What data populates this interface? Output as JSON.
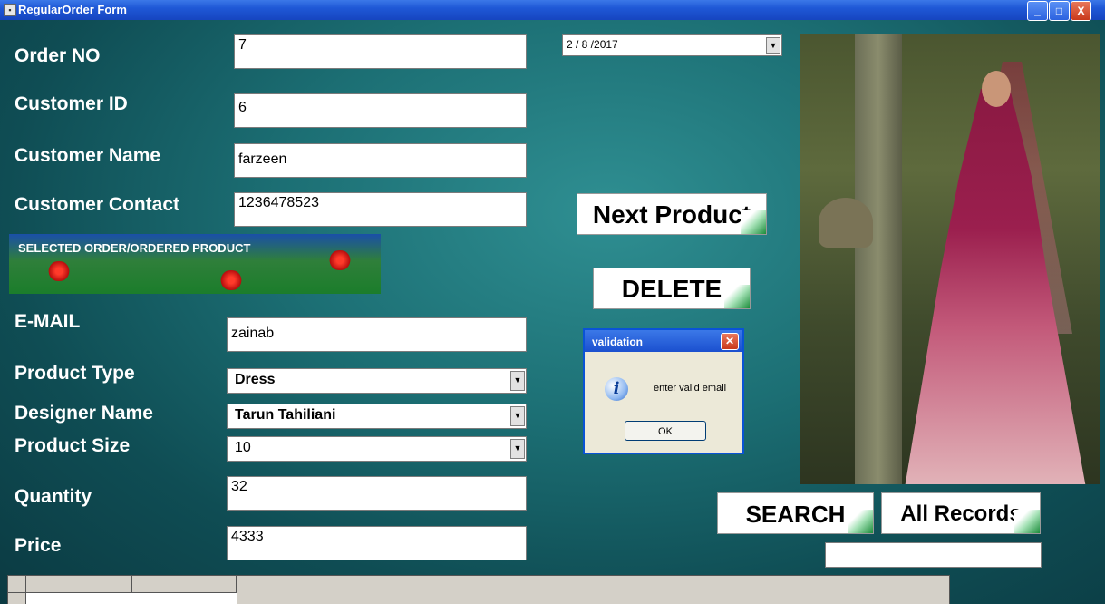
{
  "window": {
    "title": "RegularOrder Form",
    "controls": {
      "minimize": "_",
      "maximize": "□",
      "close": "X"
    }
  },
  "form": {
    "order_no": {
      "label": "Order NO",
      "value": "7"
    },
    "customer_id": {
      "label": "Customer ID",
      "value": "6"
    },
    "customer_name": {
      "label": "Customer Name",
      "value": "farzeen"
    },
    "customer_contact": {
      "label": "Customer Contact",
      "value": "1236478523"
    },
    "email": {
      "label": "E-MAIL",
      "value": "zainab"
    },
    "product_type": {
      "label": "Product Type",
      "value": "Dress"
    },
    "designer_name": {
      "label": "Designer Name",
      "value": "Tarun Tahiliani"
    },
    "product_size": {
      "label": "Product Size",
      "value": "10"
    },
    "quantity": {
      "label": "Quantity",
      "value": "32"
    },
    "price": {
      "label": "Price",
      "value": "4333"
    }
  },
  "date_picker": {
    "value": "2 / 8 /2017"
  },
  "banner": {
    "text": "SELECTED ORDER/ORDERED PRODUCT"
  },
  "buttons": {
    "next_product": "Next Product",
    "delete": "DELETE",
    "search": "SEARCH",
    "all_records": "All Records"
  },
  "dialog": {
    "title": "validation",
    "message": "enter valid email",
    "ok": "OK",
    "icon": "info-icon"
  },
  "search_box": {
    "value": ""
  },
  "colors": {
    "background": "#1c6f74",
    "titlebar": "#1f58d6",
    "label": "#ffffff"
  }
}
